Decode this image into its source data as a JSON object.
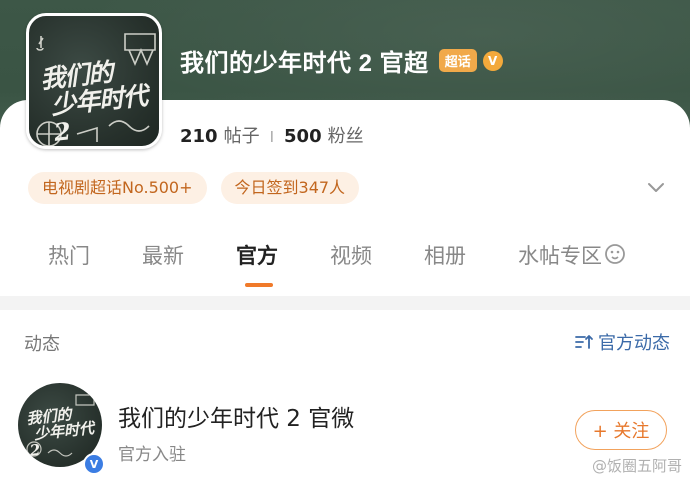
{
  "topic": {
    "title": "我们的少年时代 2 官超",
    "badge": "超话",
    "verify_mark": "V",
    "logo_text_line1": "我们的",
    "logo_text_line2": "少年时代",
    "logo_num": "2",
    "posts_count": "210",
    "posts_label": "帖子",
    "stat_separator": "I",
    "fans_count": "500",
    "fans_label": "粉丝"
  },
  "chips": [
    {
      "label": "电视剧超话No.500+"
    },
    {
      "label": "今日签到347人"
    }
  ],
  "tabs": [
    {
      "label": "热门",
      "active": false
    },
    {
      "label": "最新",
      "active": false
    },
    {
      "label": "官方",
      "active": true
    },
    {
      "label": "视频",
      "active": false
    },
    {
      "label": "相册",
      "active": false
    },
    {
      "label": "水帖专区",
      "active": false
    }
  ],
  "section": {
    "title": "动态",
    "official_feed_label": "官方动态"
  },
  "account": {
    "name": "我们的少年时代 2 官微",
    "subtitle": "官方入驻",
    "follow_label": "+ 关注",
    "verify_mark": "V",
    "logo_line1": "我们的",
    "logo_line2": "少年时代2"
  },
  "watermark": "@饭圈五阿哥",
  "colors": {
    "banner": "#3a5444",
    "accent_orange": "#f07a2a",
    "chip_bg": "#fdf0e4",
    "link_blue": "#3b6aa8",
    "verify_blue": "#3b7de3"
  }
}
